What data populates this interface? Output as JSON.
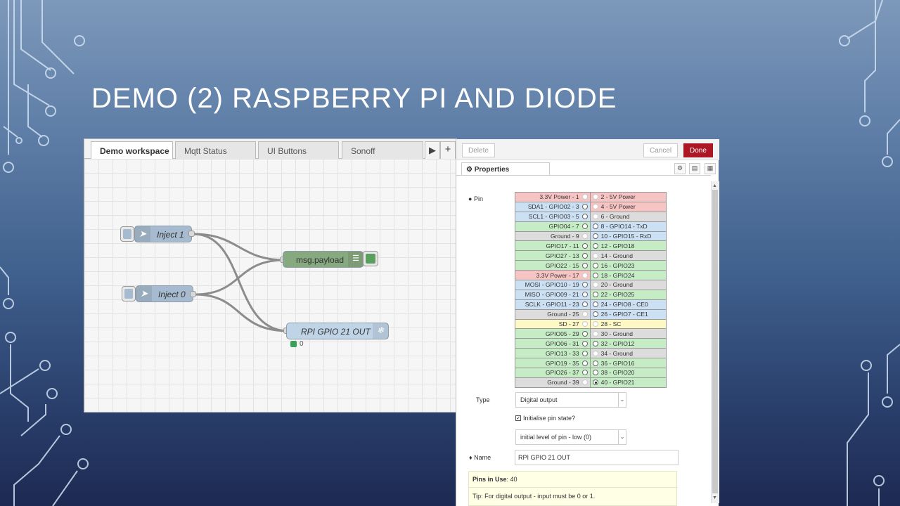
{
  "slide": {
    "title": "DEMO (2) RASPBERRY PI AND DIODE"
  },
  "editor": {
    "tabs": [
      "Demo workspace",
      "Mqtt Status",
      "UI Buttons",
      "Sonoff"
    ],
    "tab_scroll_icon": "play-right-icon",
    "add_tab_icon": "plus-icon",
    "nodes": {
      "inject1": "Inject 1",
      "inject0": "Inject 0",
      "debug": "msg.payload",
      "gpio": "RPI GPIO 21 OUT",
      "gpio_status": "0"
    },
    "colors": {
      "inject": "#a6bbcf",
      "debug": "#87a980",
      "gpio_out": "#c0d4e8",
      "status_green": "#3aa05a"
    }
  },
  "panel": {
    "delete_label": "Delete",
    "cancel_label": "Cancel",
    "done_label": "Done",
    "properties_tab": "Properties",
    "pin_label": "Pin",
    "pins": [
      {
        "left": "3.3V Power - 1",
        "right": "2 - 5V Power",
        "lc": "pink",
        "rc": "pink",
        "lr": "dis",
        "rr": "dis"
      },
      {
        "left": "SDA1 - GPIO02 - 3",
        "right": "4 - 5V Power",
        "lc": "blue",
        "rc": "pink",
        "lr": "on",
        "rr": "dis"
      },
      {
        "left": "SCL1 - GPIO03 - 5",
        "right": "6 - Ground",
        "lc": "blue",
        "rc": "gray",
        "lr": "on",
        "rr": "dis"
      },
      {
        "left": "GPIO04 - 7",
        "right": "8 - GPIO14 - TxD",
        "lc": "green",
        "rc": "blue",
        "lr": "on",
        "rr": "on"
      },
      {
        "left": "Ground - 9",
        "right": "10 - GPIO15 - RxD",
        "lc": "gray",
        "rc": "blue",
        "lr": "dis",
        "rr": "on"
      },
      {
        "left": "GPIO17 - 11",
        "right": "12 - GPIO18",
        "lc": "green",
        "rc": "green",
        "lr": "on",
        "rr": "on"
      },
      {
        "left": "GPIO27 - 13",
        "right": "14 - Ground",
        "lc": "green",
        "rc": "gray",
        "lr": "on",
        "rr": "dis"
      },
      {
        "left": "GPIO22 - 15",
        "right": "16 - GPIO23",
        "lc": "green",
        "rc": "green",
        "lr": "on",
        "rr": "on"
      },
      {
        "left": "3.3V Power - 17",
        "right": "18 - GPIO24",
        "lc": "pink",
        "rc": "green",
        "lr": "dis",
        "rr": "on"
      },
      {
        "left": "MOSI - GPIO10 - 19",
        "right": "20 - Ground",
        "lc": "blue",
        "rc": "gray",
        "lr": "on",
        "rr": "dis"
      },
      {
        "left": "MISO - GPIO09 - 21",
        "right": "22 - GPIO25",
        "lc": "blue",
        "rc": "green",
        "lr": "on",
        "rr": "on"
      },
      {
        "left": "SCLK - GPIO11 - 23",
        "right": "24 - GPIO8 - CE0",
        "lc": "blue",
        "rc": "blue",
        "lr": "on",
        "rr": "on"
      },
      {
        "left": "Ground - 25",
        "right": "26 - GPIO7 - CE1",
        "lc": "gray",
        "rc": "blue",
        "lr": "dis",
        "rr": "on"
      },
      {
        "left": "SD - 27",
        "right": "28 - SC",
        "lc": "yellow",
        "rc": "yellow",
        "lr": "dis",
        "rr": "dis"
      },
      {
        "left": "GPIO05 - 29",
        "right": "30 - Ground",
        "lc": "green",
        "rc": "gray",
        "lr": "on",
        "rr": "dis"
      },
      {
        "left": "GPIO06 - 31",
        "right": "32 - GPIO12",
        "lc": "green",
        "rc": "green",
        "lr": "on",
        "rr": "on"
      },
      {
        "left": "GPIO13 - 33",
        "right": "34 - Ground",
        "lc": "green",
        "rc": "gray",
        "lr": "on",
        "rr": "dis"
      },
      {
        "left": "GPIO19 - 35",
        "right": "36 - GPIO16",
        "lc": "green",
        "rc": "green",
        "lr": "on",
        "rr": "on"
      },
      {
        "left": "GPIO26 - 37",
        "right": "38 - GPIO20",
        "lc": "green",
        "rc": "green",
        "lr": "on",
        "rr": "on"
      },
      {
        "left": "Ground - 39",
        "right": "40 - GPIO21",
        "lc": "gray",
        "rc": "green",
        "lr": "dis",
        "rr": "sel"
      }
    ],
    "type_label": "Type",
    "type_value": "Digital output",
    "init_checkbox_label": "Initialise pin state?",
    "init_level_value": "initial level of pin - low (0)",
    "name_label": "Name",
    "name_value": "RPI GPIO 21 OUT",
    "pins_in_use_label": "Pins in Use",
    "pins_in_use_value": ": 40",
    "tip": "Tip: For digital output - input must be 0 or 1.",
    "icons": [
      "gear-icon",
      "description-icon",
      "appearance-icon"
    ]
  }
}
